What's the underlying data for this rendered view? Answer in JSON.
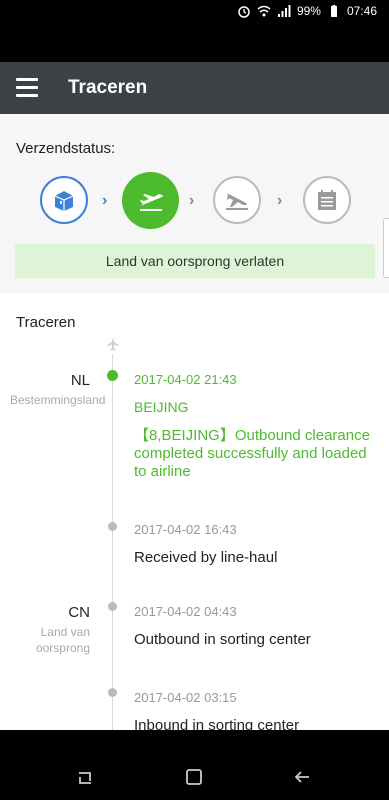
{
  "status_bar": {
    "battery": "99%",
    "time": "07:46"
  },
  "app_bar": {
    "title": "Traceren"
  },
  "shipment_status": {
    "label": "Verzendstatus:",
    "banner": "Land van oorsprong verlaten",
    "steps": [
      {
        "icon": "package-icon",
        "state": "done"
      },
      {
        "icon": "plane-departure-icon",
        "state": "current"
      },
      {
        "icon": "plane-arrival-icon",
        "state": "pending"
      },
      {
        "icon": "calendar-icon",
        "state": "pending"
      }
    ]
  },
  "tracking": {
    "title": "Traceren",
    "events": [
      {
        "country": "NL",
        "country_sub": "Bestemmingsland",
        "time": "2017-04-02 21:43",
        "location": "BEIJING",
        "desc": "【8,BEIJING】Outbound clearance completed successfully and loaded to airline",
        "active": true
      },
      {
        "country": "",
        "country_sub": "",
        "time": "2017-04-02 16:43",
        "location": "",
        "desc": "Received by line-haul",
        "active": false
      },
      {
        "country": "CN",
        "country_sub": "Land van oorsprong",
        "time": "2017-04-02 04:43",
        "location": "",
        "desc": "Outbound in sorting center",
        "active": false
      },
      {
        "country": "",
        "country_sub": "",
        "time": "2017-04-02 03:15",
        "location": "",
        "desc": "Inbound in sorting center",
        "active": false
      }
    ]
  },
  "colors": {
    "accent_green": "#4dbb2e",
    "accent_blue": "#3b82d6",
    "appbar": "#3c4246"
  }
}
